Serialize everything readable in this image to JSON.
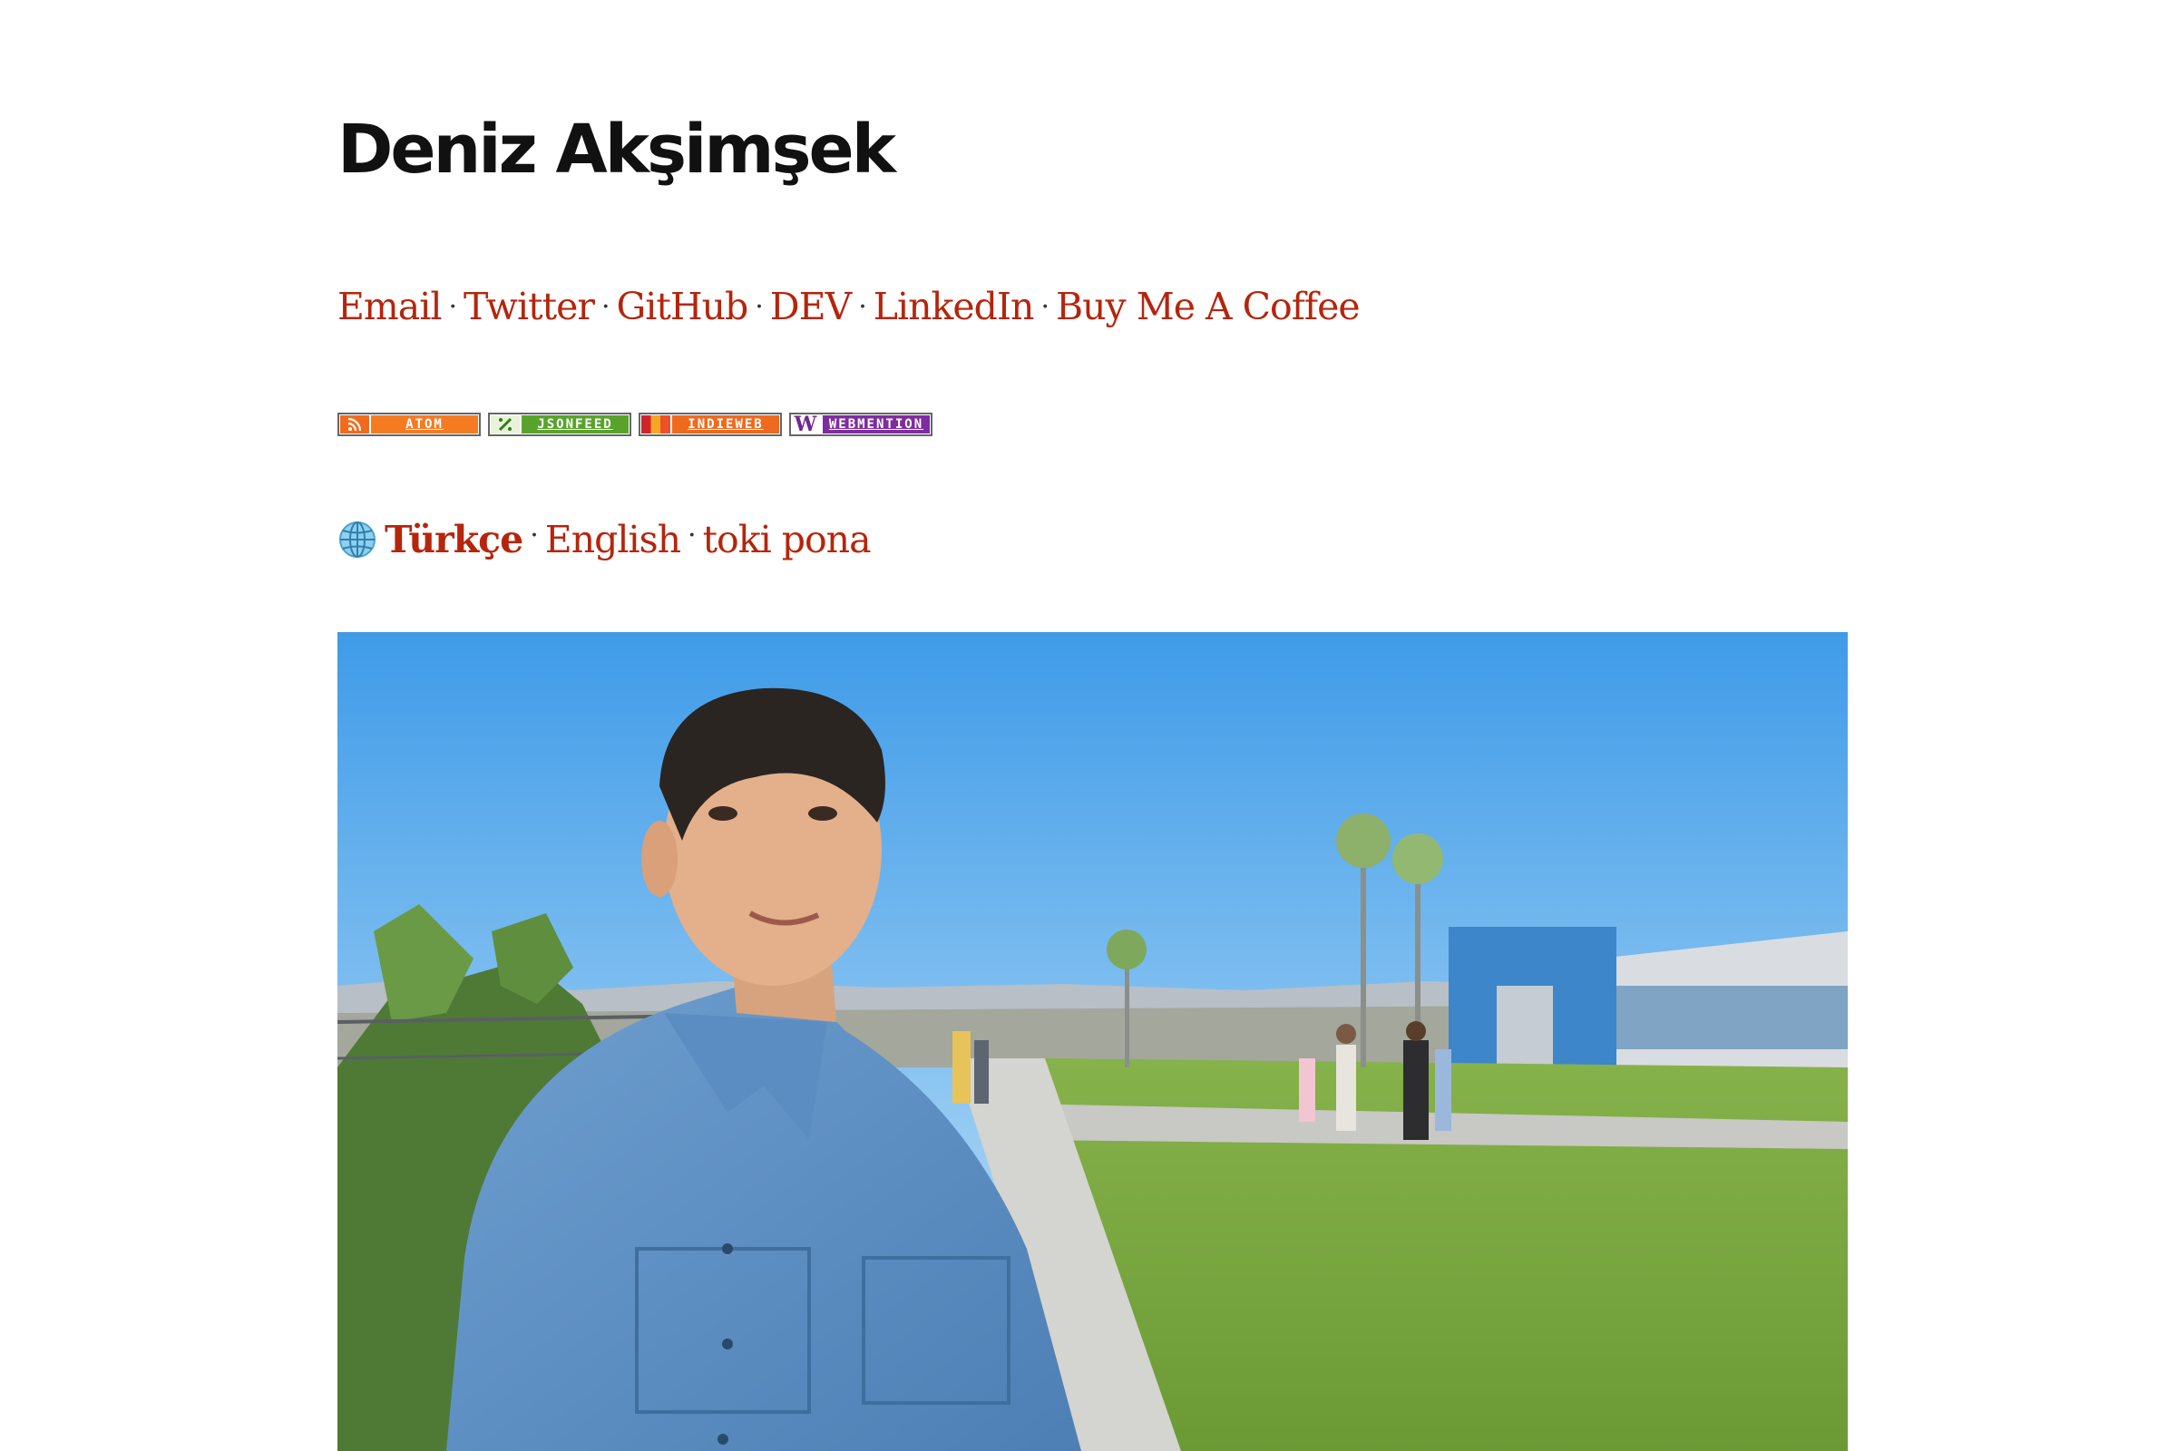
{
  "header": {
    "title": "Deniz Akşimşek"
  },
  "social": {
    "separator": "·",
    "links": [
      {
        "label": "Email"
      },
      {
        "label": "Twitter"
      },
      {
        "label": "GitHub"
      },
      {
        "label": "DEV"
      },
      {
        "label": "LinkedIn"
      },
      {
        "label": "Buy Me A Coffee"
      }
    ]
  },
  "badges": [
    {
      "label": "ATOM",
      "icon": "rss-icon"
    },
    {
      "label": "JSONFEED",
      "icon": "jsonfeed-icon"
    },
    {
      "label": "INDIEWEB",
      "icon": "indieweb-icon"
    },
    {
      "label": "WEBMENTION",
      "icon": "webmention-icon",
      "icon_letter": "W"
    }
  ],
  "languages": {
    "icon": "globe-icon",
    "current": "Türkçe",
    "separator": "·",
    "others": [
      {
        "label": "English"
      },
      {
        "label": "toki pona"
      }
    ]
  },
  "colors": {
    "link": "#b5250c",
    "text": "#111111",
    "background": "#ffffff"
  }
}
